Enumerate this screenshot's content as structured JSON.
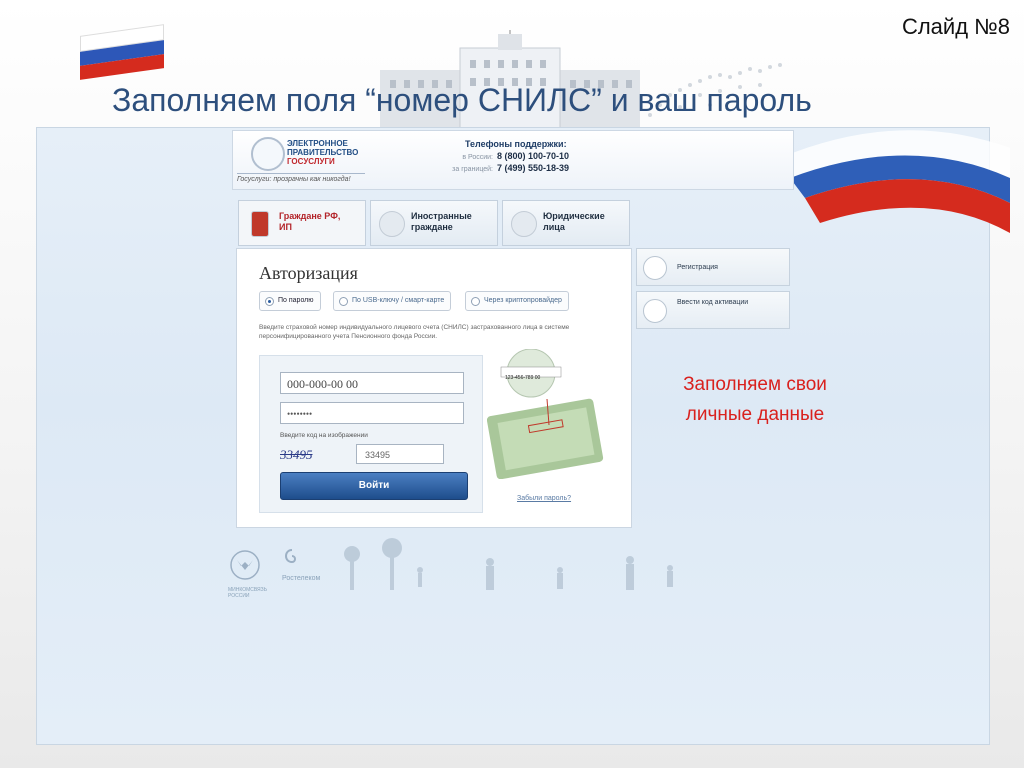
{
  "slide": {
    "number": "Слайд №8",
    "title": "Заполняем поля “номер СНИЛС” и ваш пароль",
    "note": [
      "Заполняем свои",
      "личные данные"
    ]
  },
  "site": {
    "logo_lines": [
      "ЭЛЕКТРОННОЕ",
      "ПРАВИТЕЛЬСТВО"
    ],
    "logo_red": "ГОСУСЛУГИ",
    "tagline": "Госуслуги: прозрачны как никогда!",
    "support": {
      "title": "Телефоны поддержки:",
      "rows": [
        {
          "label": "в России:",
          "number": "8 (800) 100-70-10"
        },
        {
          "label": "за границей:",
          "number": "7 (499) 550-18-39"
        }
      ]
    }
  },
  "tabs": [
    {
      "label": "Граждане РФ, ИП",
      "active": true
    },
    {
      "label": "Иностранные граждане",
      "active": false
    },
    {
      "label": "Юридические лица",
      "active": false
    }
  ],
  "auth": {
    "title": "Авторизация",
    "methods": [
      "По паролю",
      "По USB-ключу / смарт-карте",
      "Через криптопровайдер"
    ],
    "hint": "Введите страховой номер индивидуального лицевого счета (СНИЛС) застрахованного лица в системе персонифицированного учета Пенсионного фонда России.",
    "snils_value": "000-000-00 00",
    "password_value": "••••••••",
    "captcha_label": "Введите код на изображении",
    "captcha_image_text": "33495",
    "captcha_value": "33495",
    "login_button": "Войти",
    "forgot": "Забыли пароль?",
    "card_number": "123-456-789 00"
  },
  "side_buttons": [
    "Регистрация",
    "Ввести код активации"
  ],
  "footer": {
    "ministry": "МИНКОМСВЯЗЬ РОССИИ",
    "operator": "Ростелеком"
  },
  "colors": {
    "title": "#2d4f7d",
    "note": "#d9211e",
    "button": "#1e4d8c",
    "active_tab": "#b3242a"
  }
}
